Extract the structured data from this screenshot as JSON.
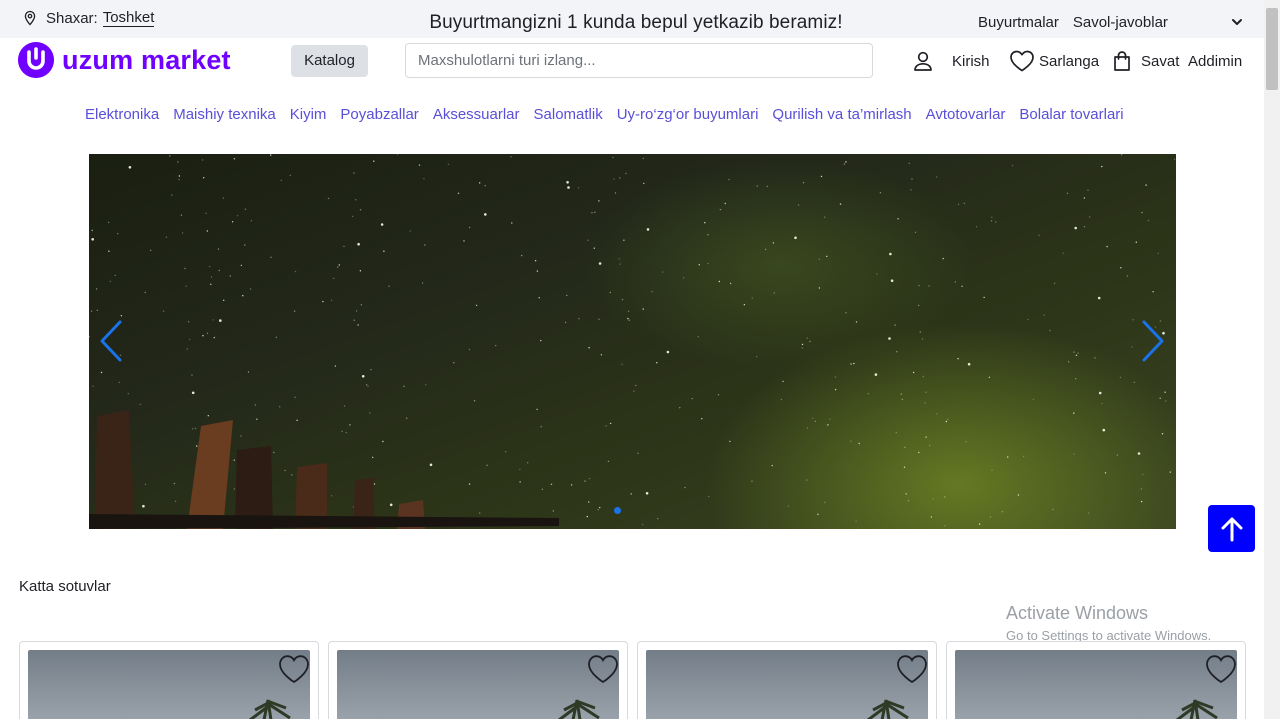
{
  "topbar": {
    "city_label": "Shaxar:",
    "city_value": "Toshket",
    "promo": "Buyurtmangizni 1 kunda bepul yetkazib beramiz!",
    "links": [
      "Buyurtmalar",
      "Savol-javoblar"
    ]
  },
  "header": {
    "logo_text": "uzum market",
    "catalog_label": "Katalog",
    "search_placeholder": "Maxshulotlarni turi izlang...",
    "login_label": "Kirish",
    "favorites_label": "Sarlanga",
    "cart_label": "Savat",
    "admin_label": "Addimin"
  },
  "categories": [
    "Elektronika",
    "Maishiy texnika",
    "Kiyim",
    "Poyabzallar",
    "Aksessuarlar",
    "Salomatlik",
    "Uy-ro‘zg‘or buyumlari",
    "Qurilish va ta’mirlash",
    "Avtotovarlar",
    "Bolalar tovarlari"
  ],
  "banner": {
    "slide_count": 1,
    "active_slide": 1
  },
  "sections": {
    "bestsellers_title": "Katta sotuvlar"
  },
  "watermark": {
    "line1": "Activate Windows",
    "line2": "Go to Settings to activate Windows."
  },
  "colors": {
    "brand": "#7000ff",
    "category_link": "#5a4fd8",
    "scroll_top_button": "#0000ff",
    "slider_arrow": "#1a73e8"
  },
  "icons": [
    "location-pin-icon",
    "chevron-down-icon",
    "user-icon",
    "heart-icon",
    "shopping-bag-icon",
    "arrow-left-icon",
    "arrow-right-icon",
    "arrow-up-icon"
  ]
}
